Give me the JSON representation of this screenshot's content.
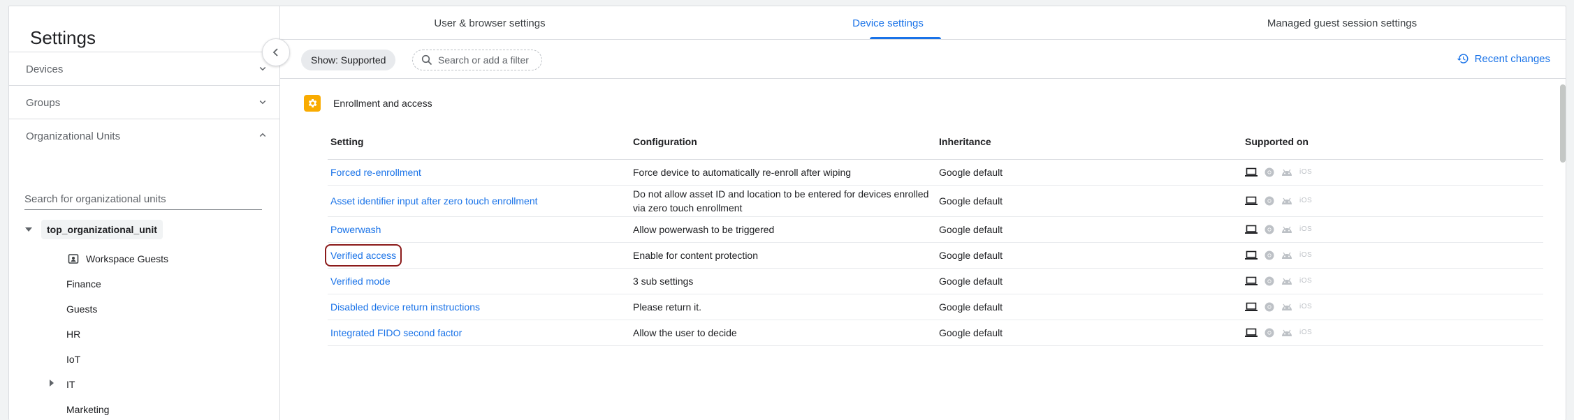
{
  "sidebar": {
    "title": "Settings",
    "sections": [
      {
        "label": "Devices",
        "expanded": false
      },
      {
        "label": "Groups",
        "expanded": false
      },
      {
        "label": "Organizational Units",
        "expanded": true
      }
    ],
    "search_placeholder": "Search for organizational units",
    "tree": {
      "root": "top_organizational_unit",
      "children": [
        {
          "label": "Workspace Guests",
          "icon": "guest-badge-icon"
        },
        {
          "label": "Finance"
        },
        {
          "label": "Guests"
        },
        {
          "label": "HR"
        },
        {
          "label": "IoT"
        },
        {
          "label": "IT",
          "has_children": true
        },
        {
          "label": "Marketing"
        }
      ]
    }
  },
  "tabs": [
    {
      "label": "User & browser settings",
      "active": false
    },
    {
      "label": "Device settings",
      "active": true
    },
    {
      "label": "Managed guest session settings",
      "active": false
    }
  ],
  "toolbar": {
    "show_chip": "Show: Supported",
    "filter_placeholder": "Search or add a filter",
    "recent_changes": "Recent changes"
  },
  "section": {
    "title": "Enrollment and access",
    "icon": "gear-icon"
  },
  "table": {
    "headers": [
      "Setting",
      "Configuration",
      "Inheritance",
      "Supported on"
    ],
    "rows": [
      {
        "setting": "Forced re-enrollment",
        "configuration": "Force device to automatically re-enroll after wiping",
        "inheritance": "Google default"
      },
      {
        "setting": "Asset identifier input after zero touch enrollment",
        "configuration": "Do not allow asset ID and location to be entered for devices enrolled via zero touch enrollment",
        "inheritance": "Google default"
      },
      {
        "setting": "Powerwash",
        "configuration": "Allow powerwash to be triggered",
        "inheritance": "Google default"
      },
      {
        "setting": "Verified access",
        "configuration": "Enable for content protection",
        "inheritance": "Google default",
        "highlighted": true
      },
      {
        "setting": "Verified mode",
        "configuration": "3 sub settings",
        "inheritance": "Google default"
      },
      {
        "setting": "Disabled device return instructions",
        "configuration": "Please return it.",
        "inheritance": "Google default"
      },
      {
        "setting": "Integrated FIDO second factor",
        "configuration": "Allow the user to decide",
        "inheritance": "Google default"
      }
    ],
    "platform_icons": [
      "laptop-icon",
      "chrome-icon",
      "android-icon",
      "ios-icon"
    ],
    "ios_label": "iOS"
  },
  "colors": {
    "accent": "#1a73e8",
    "section_icon": "#f9ab00",
    "highlight_border": "#8b1a1a"
  }
}
